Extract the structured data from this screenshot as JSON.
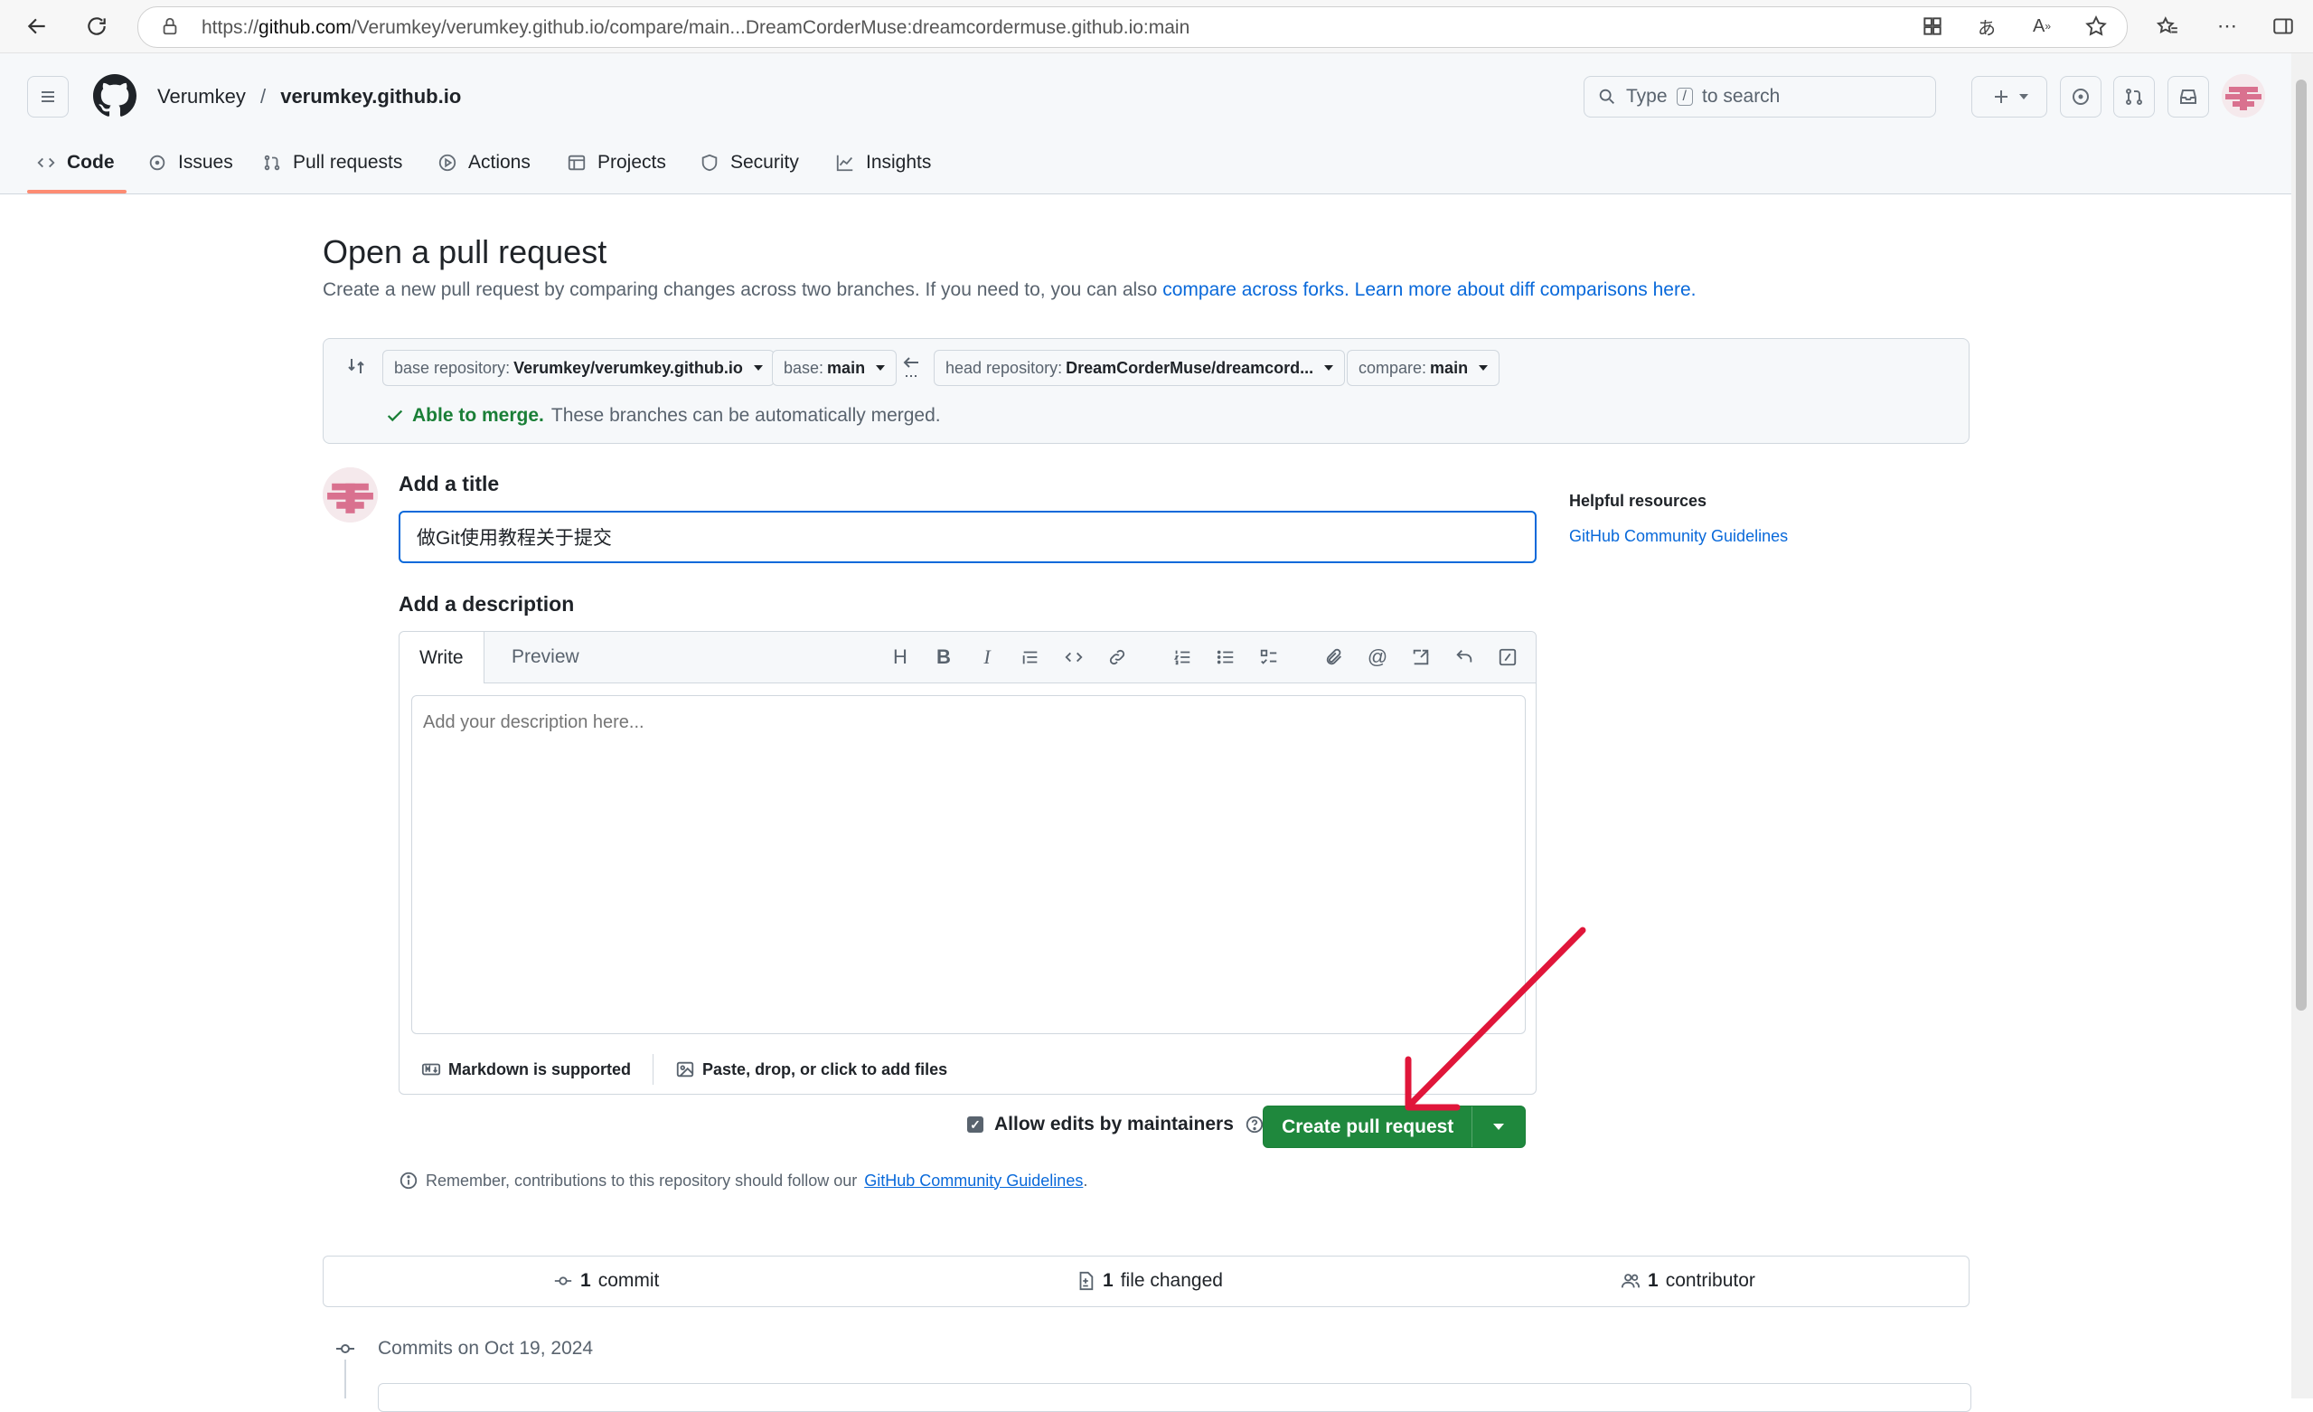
{
  "browser": {
    "url_prefix": "https://",
    "url_host": "github.com",
    "url_path": "/Verumkey/verumkey.github.io/compare/main...DreamCorderMuse:dreamcordermuse.github.io:main"
  },
  "header": {
    "owner": "Verumkey",
    "separator": "/",
    "repo": "verumkey.github.io",
    "search_prefix": "Type",
    "search_key": "/",
    "search_suffix": "to search"
  },
  "tabs": [
    {
      "label": "Code"
    },
    {
      "label": "Issues"
    },
    {
      "label": "Pull requests"
    },
    {
      "label": "Actions"
    },
    {
      "label": "Projects"
    },
    {
      "label": "Security"
    },
    {
      "label": "Insights"
    }
  ],
  "page": {
    "title": "Open a pull request",
    "subtitle": "Create a new pull request by comparing changes across two branches. If you need to, you can also",
    "subtitle_link1": "compare across forks.",
    "subtitle_link2": "Learn more about diff comparisons here."
  },
  "compare": {
    "base_repo_label": "base repository:",
    "base_repo_value": "Verumkey/verumkey.github.io",
    "base_label": "base:",
    "base_value": "main",
    "head_repo_label": "head repository:",
    "head_repo_value": "DreamCorderMuse/dreamcord...",
    "compare_label": "compare:",
    "compare_value": "main",
    "merge_status": "Able to merge.",
    "merge_text": "These branches can be automatically merged."
  },
  "form": {
    "title_label": "Add a title",
    "title_value": "做Git使用教程关于提交",
    "description_label": "Add a description",
    "tab_write": "Write",
    "tab_preview": "Preview",
    "description_placeholder": "Add your description here...",
    "markdown_note": "Markdown is supported",
    "files_note": "Paste, drop, or click to add files",
    "allow_edits": "Allow edits by maintainers",
    "create_button": "Create pull request",
    "remember_text": "Remember, contributions to this repository should follow our",
    "remember_link": "GitHub Community Guidelines",
    "remember_end": "."
  },
  "sidebar": {
    "heading": "Helpful resources",
    "link": "GitHub Community Guidelines"
  },
  "stats": {
    "commits_count": "1",
    "commits_label": "commit",
    "files_count": "1",
    "files_label": "file changed",
    "contributors_count": "1",
    "contributors_label": "contributor"
  },
  "commits": {
    "heading": "Commits on Oct 19, 2024"
  },
  "colors": {
    "accent_blue": "#0969da",
    "success_green": "#1f883d",
    "annotation_red": "#e0163a",
    "tab_underline": "#fd8c73"
  }
}
